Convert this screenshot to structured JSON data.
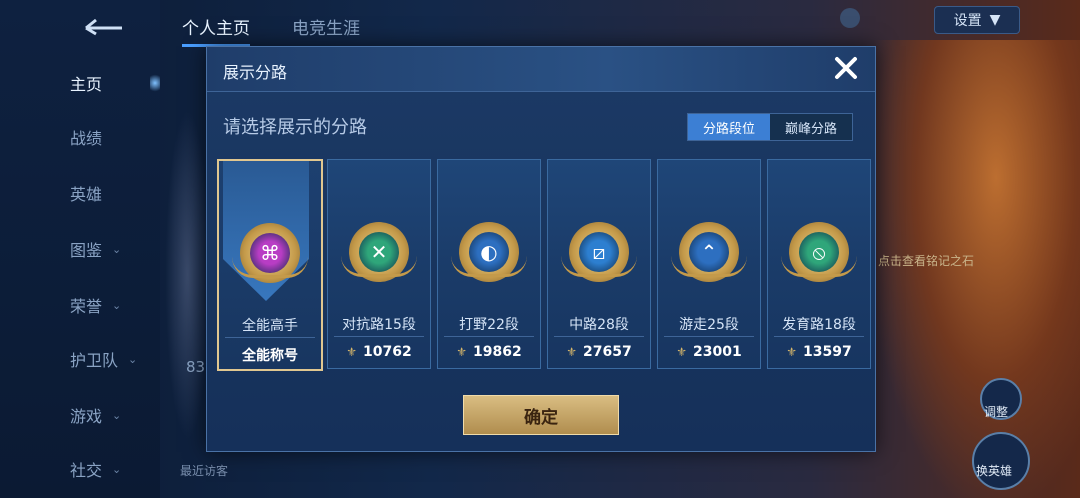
{
  "sidebar": {
    "items": [
      {
        "label": "主页",
        "active": true,
        "chevron": false
      },
      {
        "label": "战绩",
        "active": false,
        "chevron": false
      },
      {
        "label": "英雄",
        "active": false,
        "chevron": false
      },
      {
        "label": "图鉴",
        "active": false,
        "chevron": true
      },
      {
        "label": "荣誉",
        "active": false,
        "chevron": true
      },
      {
        "label": "护卫队",
        "active": false,
        "chevron": true
      },
      {
        "label": "游戏",
        "active": false,
        "chevron": true
      },
      {
        "label": "社交",
        "active": false,
        "chevron": true
      }
    ]
  },
  "topbar": {
    "tabs": [
      {
        "label": "个人主页",
        "active": true
      },
      {
        "label": "电竞生涯",
        "active": false
      }
    ],
    "settings_label": "设置"
  },
  "background": {
    "visitor_label": "最近访客",
    "left_number": "83",
    "right_label": "点击查看铭记之石",
    "right_btn1_label": "调整",
    "right_btn2_label": "换英雄"
  },
  "modal": {
    "title": "展示分路",
    "subtitle": "请选择展示的分路",
    "toggle": [
      {
        "label": "分路段位",
        "active": true
      },
      {
        "label": "巅峰分路",
        "active": false
      }
    ],
    "cards": [
      {
        "label": "全能高手",
        "value": "全能称号",
        "icon": "all-round-badge-icon",
        "color": "#b83dc4",
        "selected": true,
        "show_power": false
      },
      {
        "label": "对抗路15段",
        "value": "10762",
        "icon": "clash-lane-badge-icon",
        "color": "#2fa67a",
        "selected": false,
        "show_power": true
      },
      {
        "label": "打野22段",
        "value": "19862",
        "icon": "jungle-badge-icon",
        "color": "#2d6fc0",
        "selected": false,
        "show_power": true
      },
      {
        "label": "中路28段",
        "value": "27657",
        "icon": "mid-lane-badge-icon",
        "color": "#2d7fd0",
        "selected": false,
        "show_power": true
      },
      {
        "label": "游走25段",
        "value": "23001",
        "icon": "roam-badge-icon",
        "color": "#2d6fc0",
        "selected": false,
        "show_power": true
      },
      {
        "label": "发育路18段",
        "value": "13597",
        "icon": "farm-lane-badge-icon",
        "color": "#2fa67a",
        "selected": false,
        "show_power": true
      }
    ],
    "confirm_label": "确定"
  }
}
